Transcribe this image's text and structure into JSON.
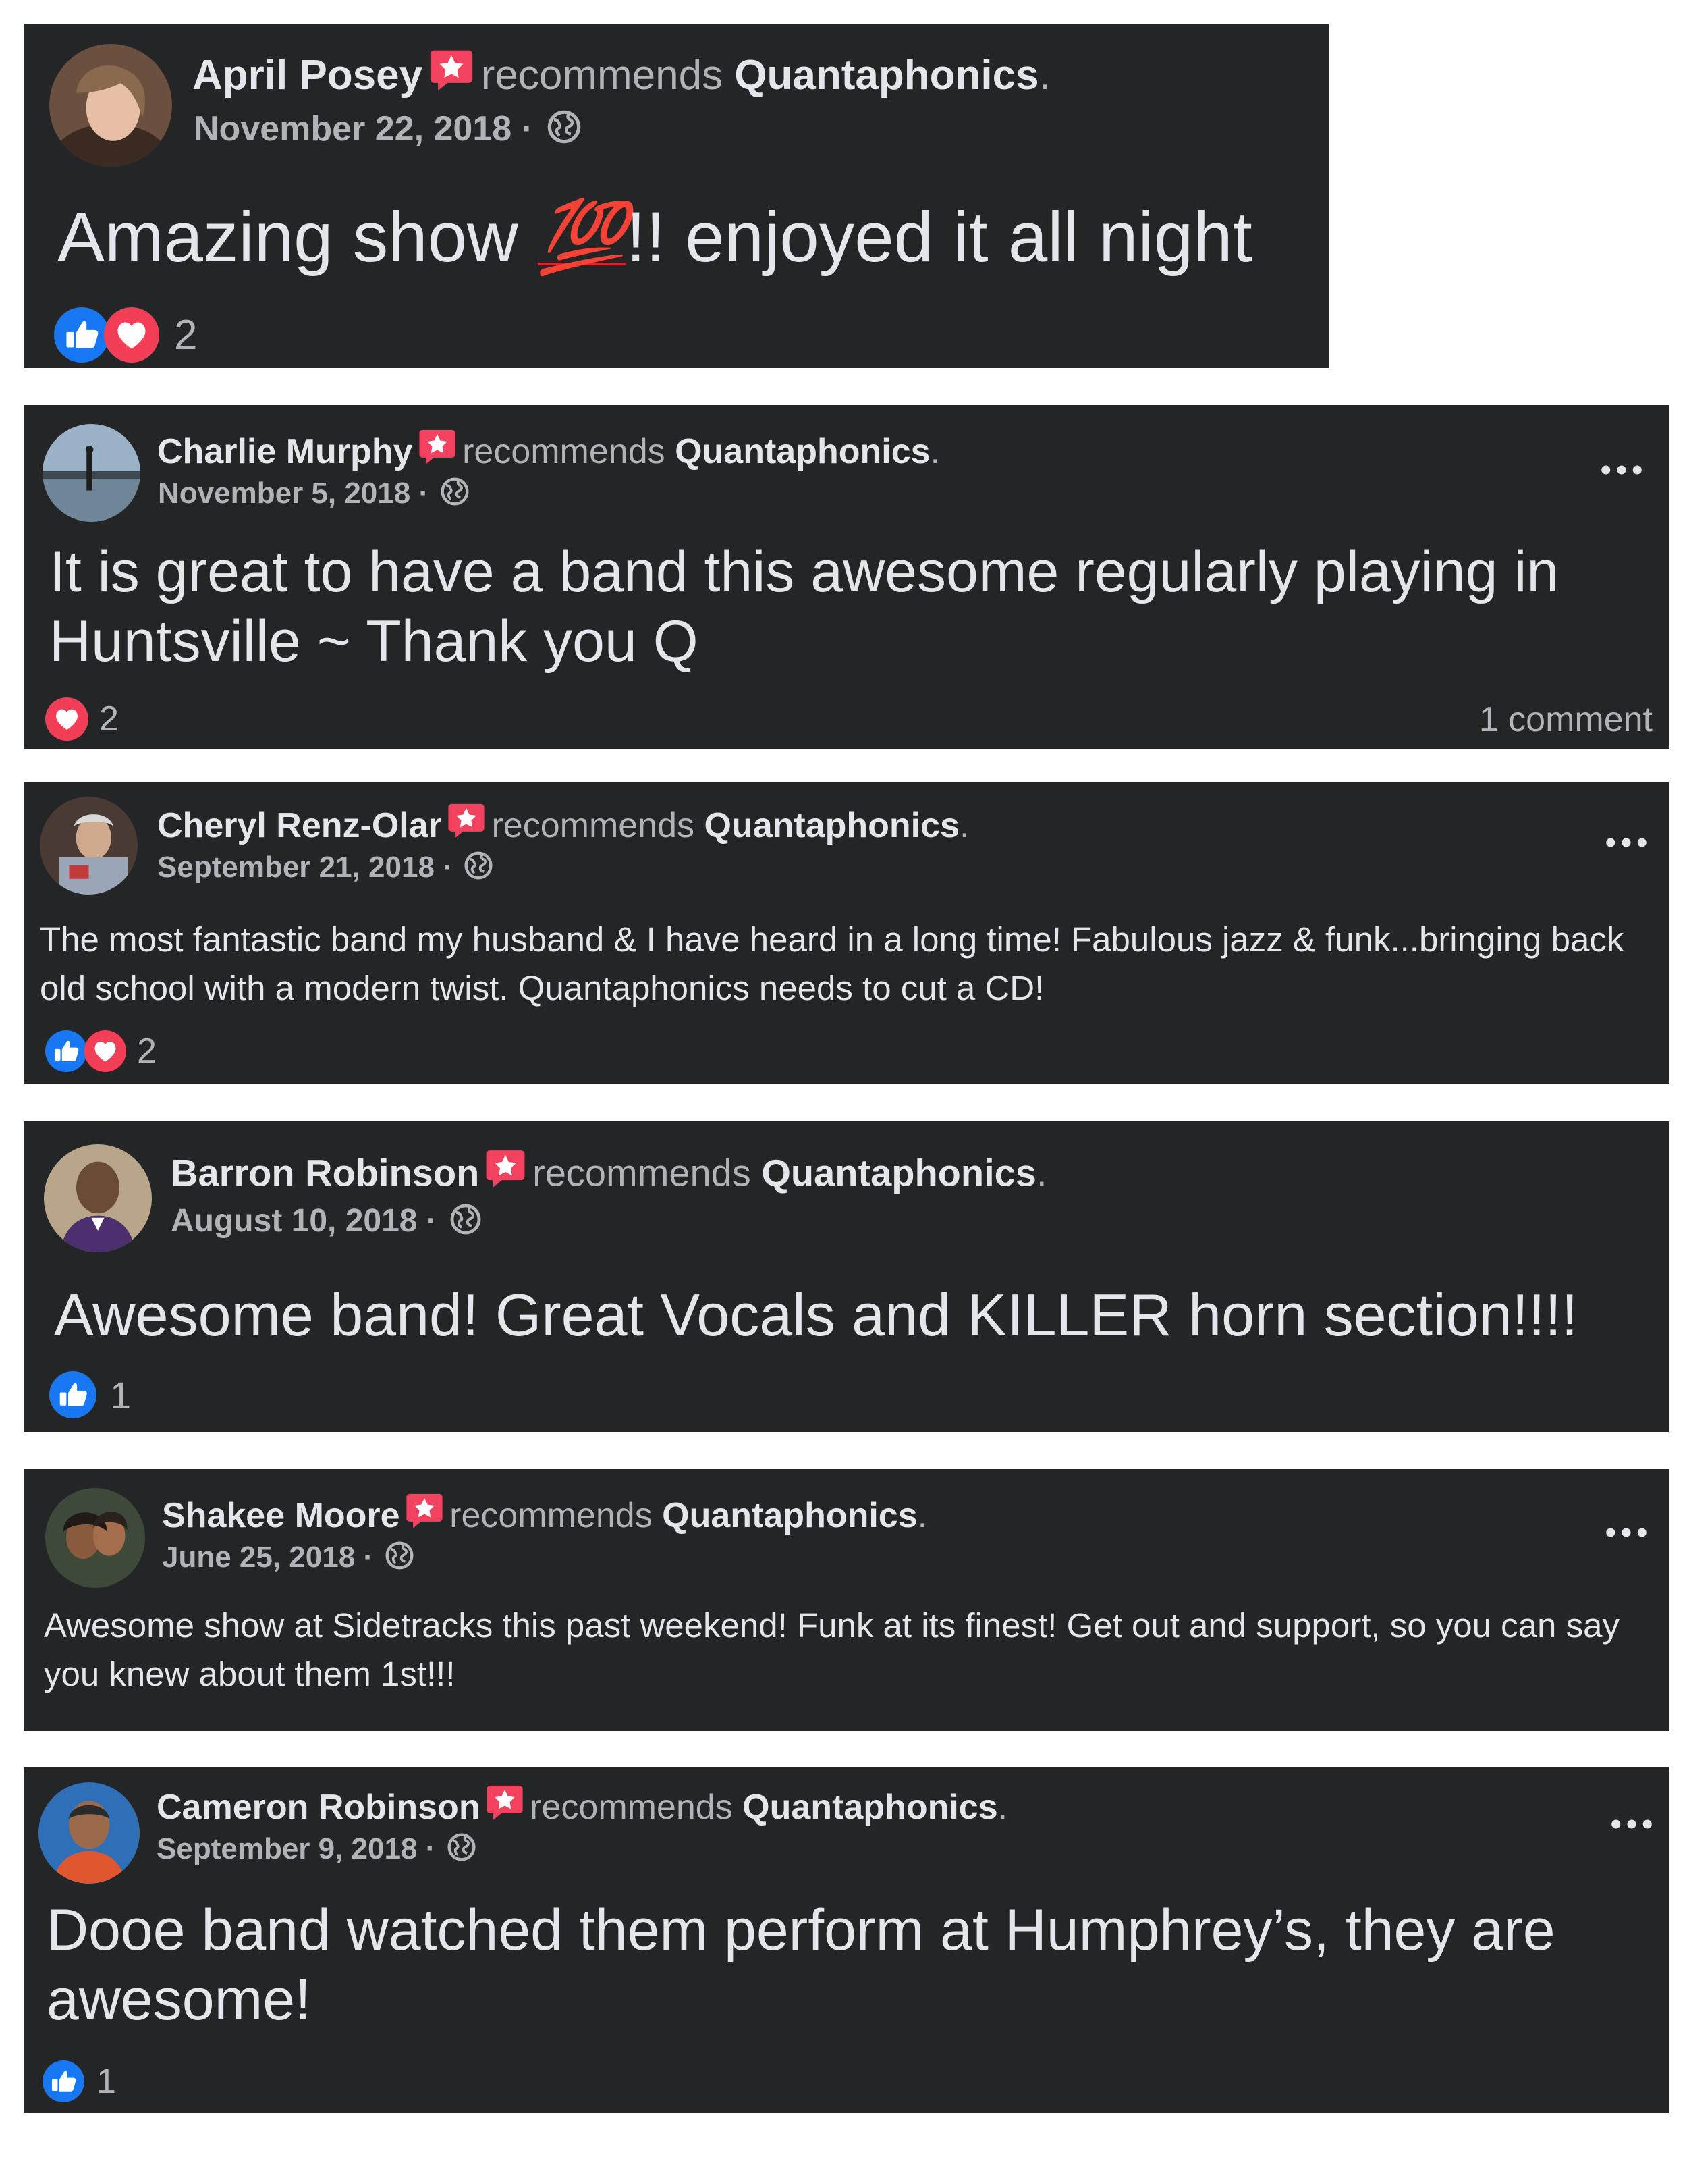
{
  "common": {
    "recommends": "recommends",
    "page_name": "Quantaphonics",
    "period": ".",
    "date_separator": " · "
  },
  "reviews": [
    {
      "reviewer": "April Posey",
      "date": "November 22, 2018",
      "text_before": "Amazing show ",
      "emoji": "💯",
      "text_after": "!! enjoyed it all night",
      "reaction_count": "2",
      "reactions": [
        "like",
        "love"
      ]
    },
    {
      "reviewer": "Charlie Murphy",
      "date": "November 5, 2018",
      "text": "It is great to have a band this awesome regularly playing in Huntsville ~ Thank you Q",
      "reaction_count": "2",
      "reactions": [
        "love"
      ],
      "comment_count": "1 comment"
    },
    {
      "reviewer": "Cheryl Renz-Olar",
      "date": "September 21, 2018",
      "text": "The most fantastic band my husband & I have heard in a long time! Fabulous jazz & funk...bringing back old school with a modern twist. Quantaphonics needs to cut a CD!",
      "reaction_count": "2",
      "reactions": [
        "like",
        "love"
      ]
    },
    {
      "reviewer": "Barron Robinson",
      "date": "August 10, 2018",
      "text": "Awesome band! Great Vocals and KILLER horn section!!!!",
      "reaction_count": "1",
      "reactions": [
        "like"
      ]
    },
    {
      "reviewer": "Shakee Moore",
      "date": "June 25, 2018",
      "text": "Awesome show at Sidetracks this past weekend! Funk at its finest! Get out and support, so you can say you knew about them 1st!!!"
    },
    {
      "reviewer": "Cameron Robinson",
      "date": "September 9, 2018",
      "text": "Dooe band watched them perform at Humphrey’s, they are awesome!",
      "reaction_count": "1",
      "reactions": [
        "like"
      ]
    }
  ],
  "colors": {
    "card_background": "#242526",
    "primary_text": "#e4e6eb",
    "secondary_text": "#b0b3b8",
    "recommend_badge": "#f3425f",
    "like_blue": "#1877f2",
    "love_red": "#f33e58"
  }
}
